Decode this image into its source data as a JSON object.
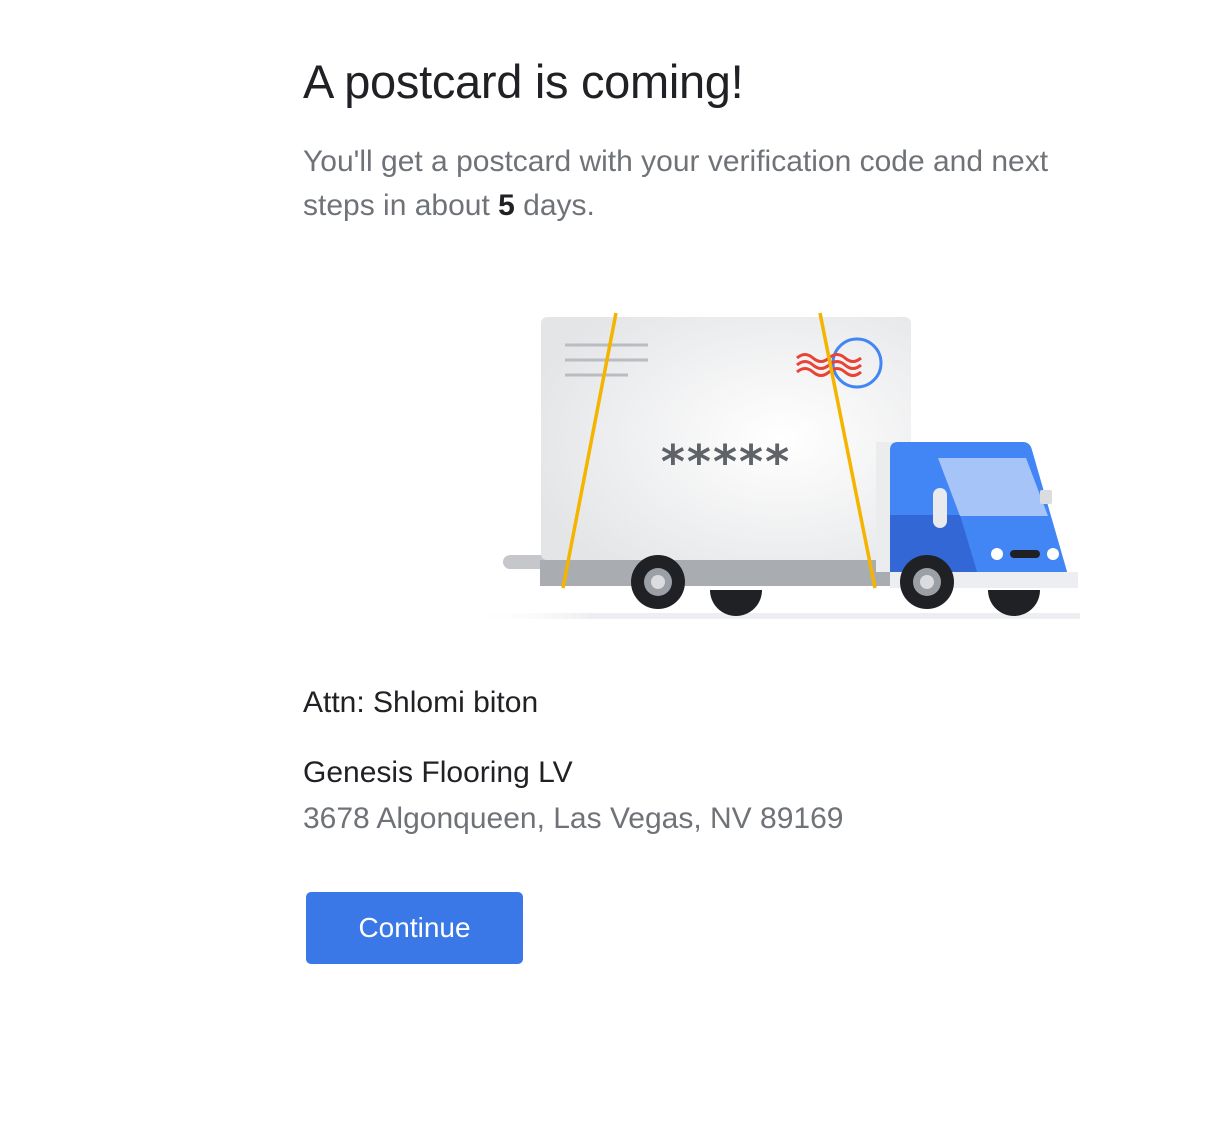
{
  "heading": {
    "title": "A postcard is coming!"
  },
  "message": {
    "text_before": "You'll get a postcard with your verification code and next steps in about ",
    "days": "5",
    "text_after": " days."
  },
  "illustration": {
    "code_mask": "*****",
    "icon": "truck-postcard-illustration"
  },
  "recipient": {
    "attn": "Attn: Shlomi biton",
    "business_name": "Genesis Flooring LV",
    "address": "3678 Algonqueen, Las Vegas, NV 89169"
  },
  "actions": {
    "continue_label": "Continue"
  },
  "colors": {
    "primary": "#3b78e7",
    "title_text": "#202124",
    "secondary_text": "#6f7378"
  }
}
